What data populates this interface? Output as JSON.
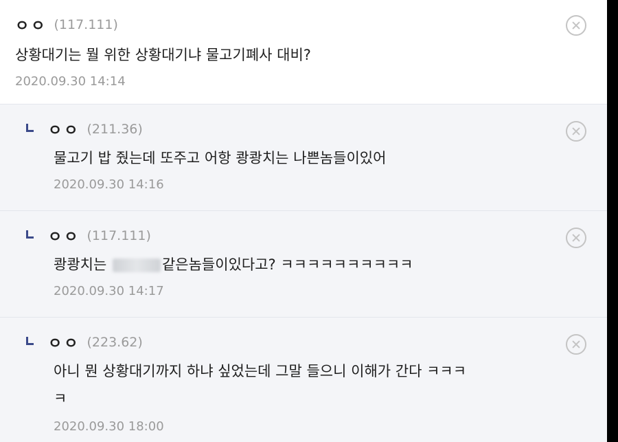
{
  "comments": [
    {
      "nick": "ㅇㅇ",
      "ip": "(117.111)",
      "text": "상황대기는 뭘 위한 상황대기냐 물고기폐사 대비?",
      "time": "2020.09.30 14:14",
      "is_reply": false
    },
    {
      "nick": "ㅇㅇ",
      "ip": "(211.36)",
      "text": "물고기 밥 줬는데 또주고 어항 쾅쾅치는 나쁜놈들이있어",
      "time": "2020.09.30 14:16",
      "is_reply": true
    },
    {
      "nick": "ㅇㅇ",
      "ip": "(117.111)",
      "text_before": "쾅쾅치는",
      "text_after": "같은놈들이있다고? ㅋㅋㅋㅋㅋㅋㅋㅋㅋㅋ",
      "time": "2020.09.30 14:17",
      "is_reply": true
    },
    {
      "nick": "ㅇㅇ",
      "ip": "(223.62)",
      "text_line1": "아니 뭔 상황대기까지 하냐 싶었는데 그말 들으니 이해가 간다 ㅋㅋㅋ",
      "text_line2": "ㅋ",
      "time": "2020.09.30 18:00",
      "is_reply": true
    }
  ],
  "icons": {
    "delete": "close-circle-icon",
    "reply": "reply-arrow-icon"
  },
  "colors": {
    "reply_bg": "#f4f5f8",
    "reply_icon": "#3b4a8a",
    "meta_text": "#9a9a9a"
  }
}
